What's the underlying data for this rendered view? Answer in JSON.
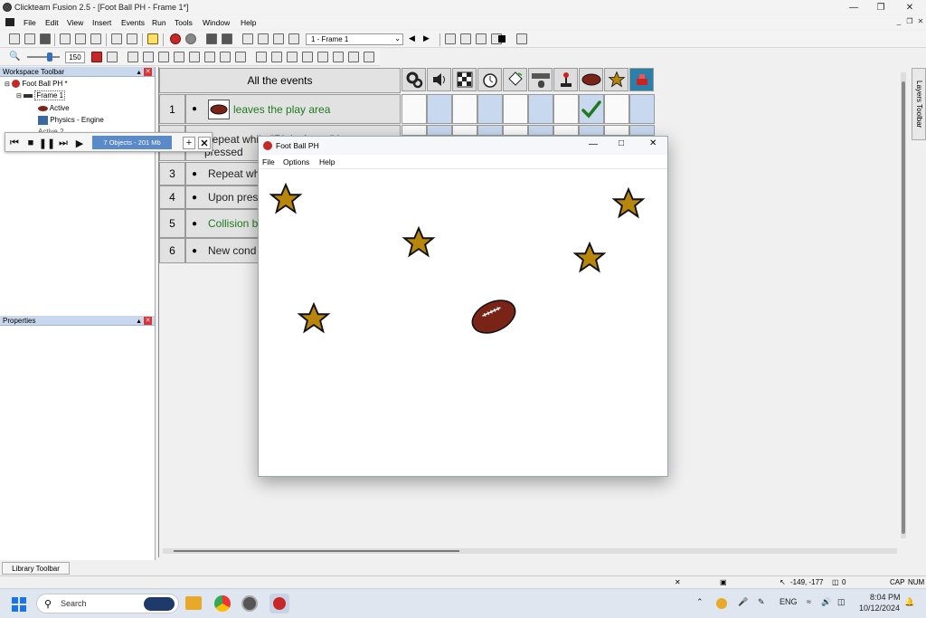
{
  "window": {
    "title": "Clickteam Fusion 2.5 - [Foot Ball PH - Frame 1*]"
  },
  "menu": [
    "File",
    "Edit",
    "View",
    "Insert",
    "Events",
    "Run",
    "Tools",
    "Window",
    "Help"
  ],
  "toolbar": {
    "zoom_value": "150",
    "frame_select": "1 - Frame 1"
  },
  "workspace": {
    "title": "Workspace Toolbar",
    "tree": [
      "Foot Ball PH *",
      "Frame 1",
      "Active",
      "Physics - Engine",
      "Active 2"
    ]
  },
  "properties": {
    "title": "Properties"
  },
  "player": {
    "objects": "7 Objects - 201 Mb"
  },
  "editor": {
    "header": "All the events",
    "events": [
      {
        "num": "1",
        "text": "leaves the play area",
        "green": true
      },
      {
        "num": "2",
        "text": "Repeat while \"Right Arrow\" is pressed",
        "green": false
      },
      {
        "num": "3",
        "text": "Repeat wh",
        "green": false
      },
      {
        "num": "4",
        "text": "Upon pres",
        "green": false
      },
      {
        "num": "5",
        "text": "Collision b",
        "green": true
      },
      {
        "num": "6",
        "text": "New cond",
        "green": false
      }
    ],
    "check_row1_col": 8
  },
  "game": {
    "title": "Foot Ball PH",
    "menu": [
      "File",
      "Options",
      "Help"
    ]
  },
  "layers": {
    "title": "Layers Toolbar"
  },
  "library": {
    "title": "Library Toolbar"
  },
  "status": {
    "coords": "-149, -177",
    "count": "0",
    "cap": "CAP",
    "num": "NUM"
  },
  "taskbar": {
    "search_placeholder": "Search",
    "lang": "ENG",
    "time": "8:04 PM",
    "date": "10/12/2024"
  },
  "colors": {
    "star": "#b8860b",
    "ball": "#7a2418",
    "check": "#1f7a1f",
    "panel_head": "#c9d8ec",
    "player_info": "#5a8ac8"
  }
}
